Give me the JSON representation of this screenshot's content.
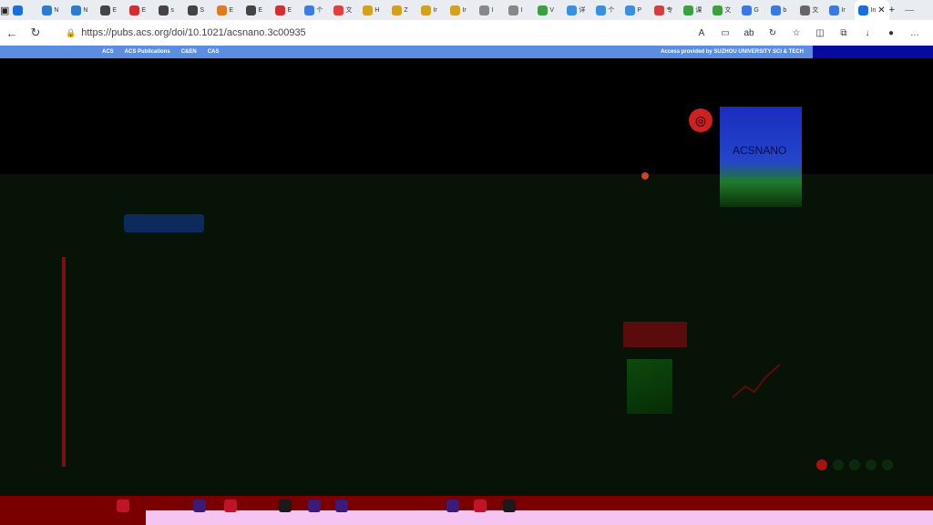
{
  "browser": {
    "tabs": [
      {
        "label": "",
        "favicon_color": "#1b6fd8"
      },
      {
        "label": "N",
        "favicon_color": "#2c7ccf"
      },
      {
        "label": "N",
        "favicon_color": "#2c7ccf"
      },
      {
        "label": "E",
        "favicon_color": "#444444"
      },
      {
        "label": "E",
        "favicon_color": "#d23030"
      },
      {
        "label": "s",
        "favicon_color": "#444444"
      },
      {
        "label": "S",
        "favicon_color": "#444444"
      },
      {
        "label": "E",
        "favicon_color": "#e07a20"
      },
      {
        "label": "E",
        "favicon_color": "#444444"
      },
      {
        "label": "E",
        "favicon_color": "#d23030"
      },
      {
        "label": "个",
        "favicon_color": "#3b7de0"
      },
      {
        "label": "文",
        "favicon_color": "#e04040"
      },
      {
        "label": "H",
        "favicon_color": "#d4a020"
      },
      {
        "label": "Z",
        "favicon_color": "#d4a020"
      },
      {
        "label": "Ir",
        "favicon_color": "#d4a020"
      },
      {
        "label": "Ir",
        "favicon_color": "#d4a020"
      },
      {
        "label": "I",
        "favicon_color": "#888888"
      },
      {
        "label": "I",
        "favicon_color": "#888888"
      },
      {
        "label": "V",
        "favicon_color": "#3aa040"
      },
      {
        "label": "详",
        "favicon_color": "#3a90e0"
      },
      {
        "label": "个",
        "favicon_color": "#3a90e0"
      },
      {
        "label": "P",
        "favicon_color": "#3a90e0"
      },
      {
        "label": "专",
        "favicon_color": "#d04040"
      },
      {
        "label": "课",
        "favicon_color": "#3aa040"
      },
      {
        "label": "文",
        "favicon_color": "#3aa040"
      },
      {
        "label": "G",
        "favicon_color": "#3a7ae0"
      },
      {
        "label": "b",
        "favicon_color": "#3a7ae0"
      },
      {
        "label": "文",
        "favicon_color": "#666666"
      },
      {
        "label": "Ir",
        "favicon_color": "#3a7ae0"
      }
    ],
    "active_tab": {
      "label": "In",
      "favicon_color": "#1b6fd8"
    },
    "new_tab_label": "+",
    "url": "https://pubs.acs.org/doi/10.1021/acsnano.3c00935",
    "window_controls": [
      "—",
      "❐",
      "✕"
    ]
  },
  "acs_bar": {
    "links": [
      "ACS",
      "ACS Publications",
      "C&EN",
      "CAS"
    ],
    "access_text": "Access provided by SUZHOU UNIVERSITY SCI & TECH"
  },
  "journal": {
    "cover_title": "ACSNANO"
  },
  "colors": {
    "acs_bar": "#5b8de0",
    "access_block": "#050aa0",
    "taskbar": "#7a0000",
    "taskbar_strip": "#f6c4f0"
  }
}
